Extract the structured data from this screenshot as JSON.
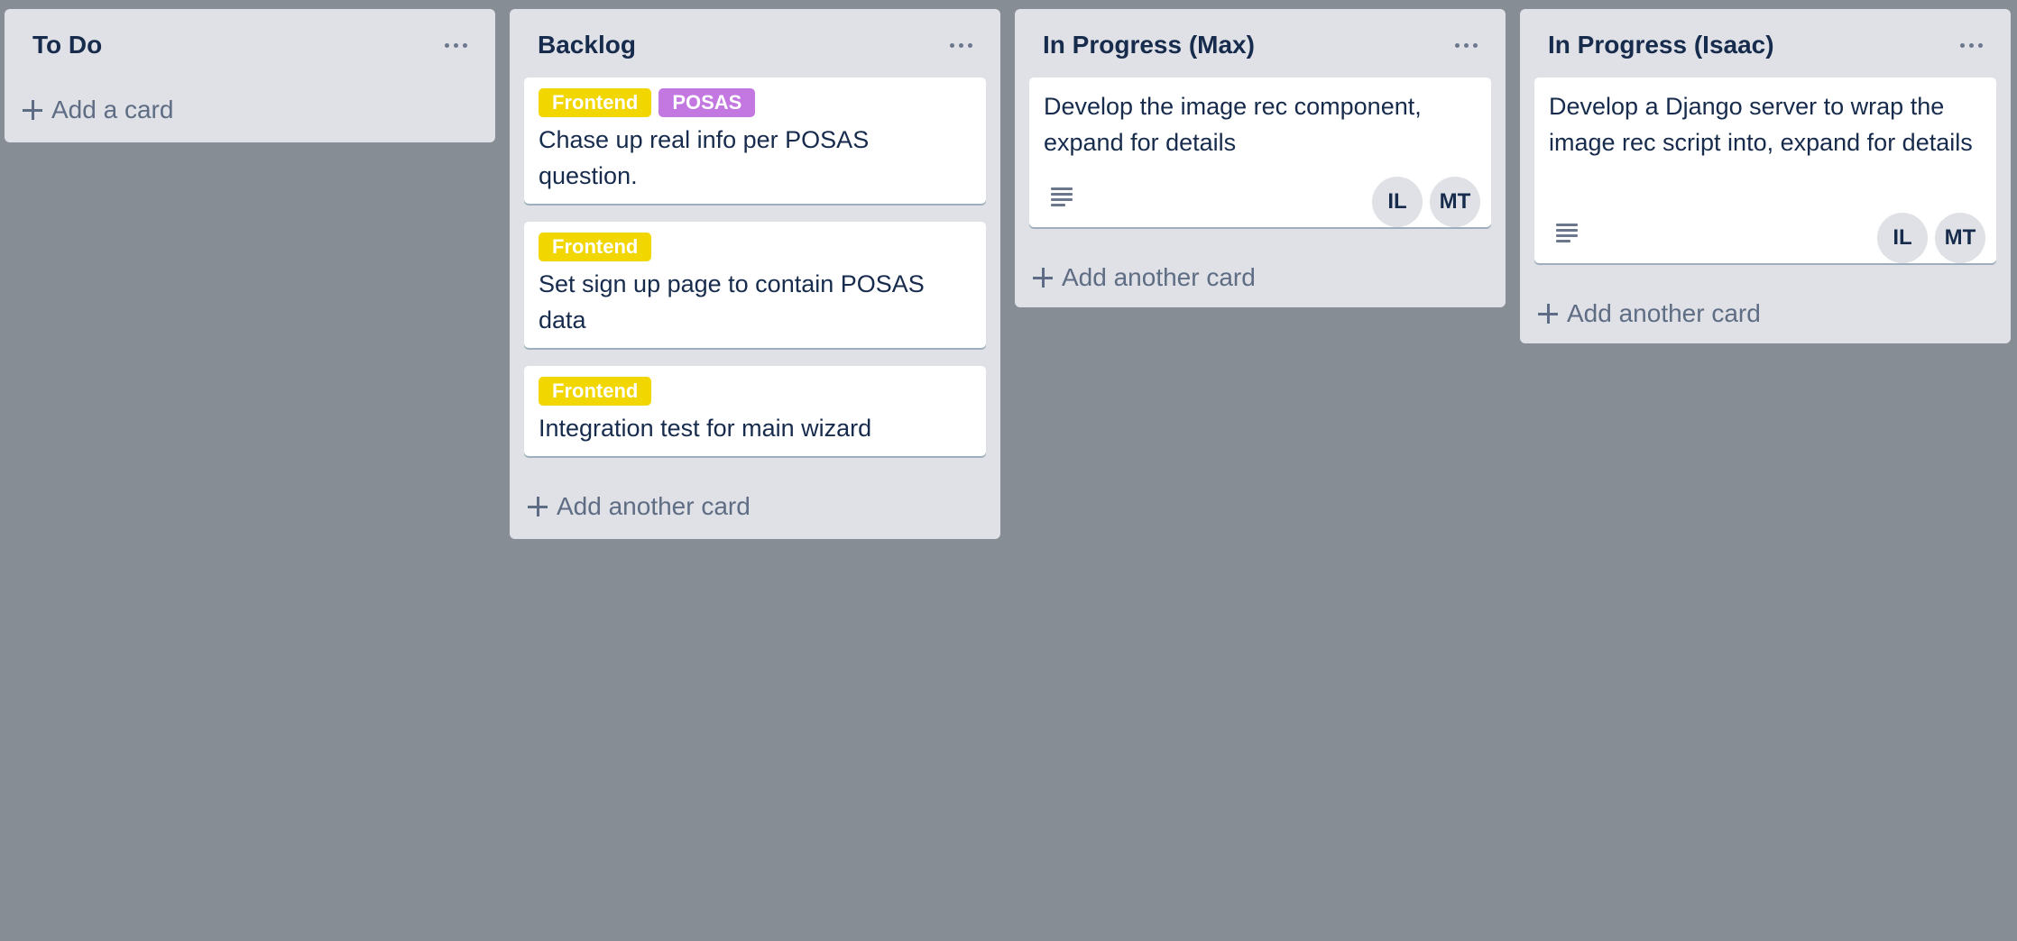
{
  "colors": {
    "board_background": "#878d94",
    "list_background": "#dfe1e6",
    "label_frontend": "#f2d600",
    "label_posas": "#c377e0",
    "avatar_background": "#dfe1e6"
  },
  "lists": [
    {
      "title": "To Do",
      "menu_icon": "more-horizontal-icon",
      "add_label": "Add a card",
      "cards": []
    },
    {
      "title": "Backlog",
      "menu_icon": "more-horizontal-icon",
      "add_label": "Add another card",
      "cards": [
        {
          "labels": [
            "Frontend",
            "POSAS"
          ],
          "title": "Chase up real info per POSAS question."
        },
        {
          "labels": [
            "Frontend"
          ],
          "title": "Set sign up page to contain POSAS data"
        },
        {
          "labels": [
            "Frontend"
          ],
          "title": "Integration test for main wizard"
        }
      ]
    },
    {
      "title": "In Progress (Max)",
      "menu_icon": "more-horizontal-icon",
      "add_label": "Add another card",
      "cards": [
        {
          "title": "Develop the image rec component, expand for details",
          "description_icon": "description-icon",
          "members": [
            "IL",
            "MT"
          ]
        }
      ]
    },
    {
      "title": "In Progress (Isaac)",
      "menu_icon": "more-horizontal-icon",
      "add_label": "Add another card",
      "cards": [
        {
          "title": "Develop a Django server to wrap the image rec script into, expand for details",
          "description_icon": "description-icon",
          "members": [
            "IL",
            "MT"
          ]
        }
      ]
    }
  ]
}
